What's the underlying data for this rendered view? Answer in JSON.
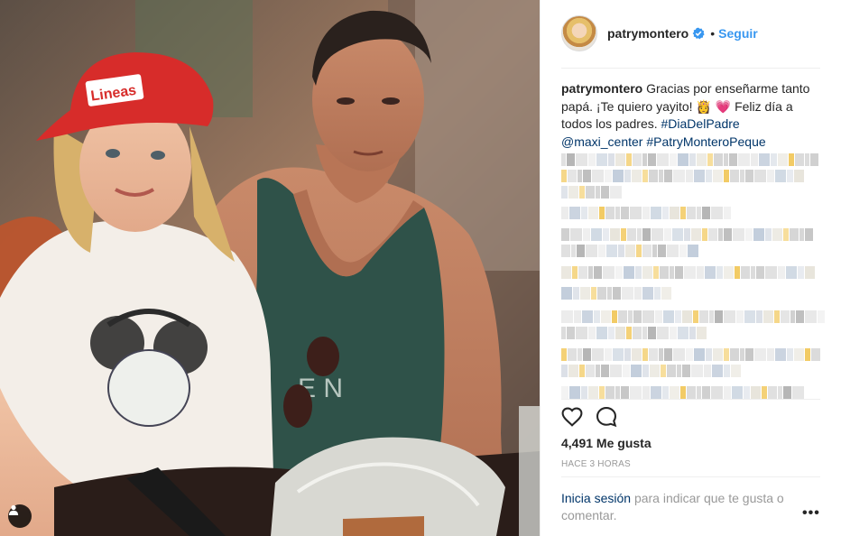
{
  "post": {
    "photo_alt": "Foto de una niña con gorra roja junto a su padre",
    "user_tag_icon": "person-icon"
  },
  "header": {
    "username": "patrymontero",
    "verified_icon": "verified-badge-icon",
    "separator": "•",
    "follow_label": "Seguir"
  },
  "caption": {
    "username": "patrymontero",
    "text_1": "Gracias por enseñarme tanto papá. ¡Te quiero yayito! 👸 💗 Feliz día a todos los padres.",
    "hashtag_1": "#DiaDelPadre",
    "mention_1": "@maxi_center",
    "hashtag_2": "#PatryMonteroPeque"
  },
  "actions": {
    "like_icon": "heart-icon",
    "comment_icon": "comment-icon"
  },
  "likes_text": "4,491 Me gusta",
  "timestamp": "HACE 3 HORAS",
  "login_prompt": {
    "link": "Inicia sesión",
    "text": "para indicar que te gusta o comentar."
  },
  "more_label": "•••",
  "colors": {
    "accent": "#3897f0",
    "link": "#003569",
    "muted": "#999999",
    "text": "#262626"
  }
}
